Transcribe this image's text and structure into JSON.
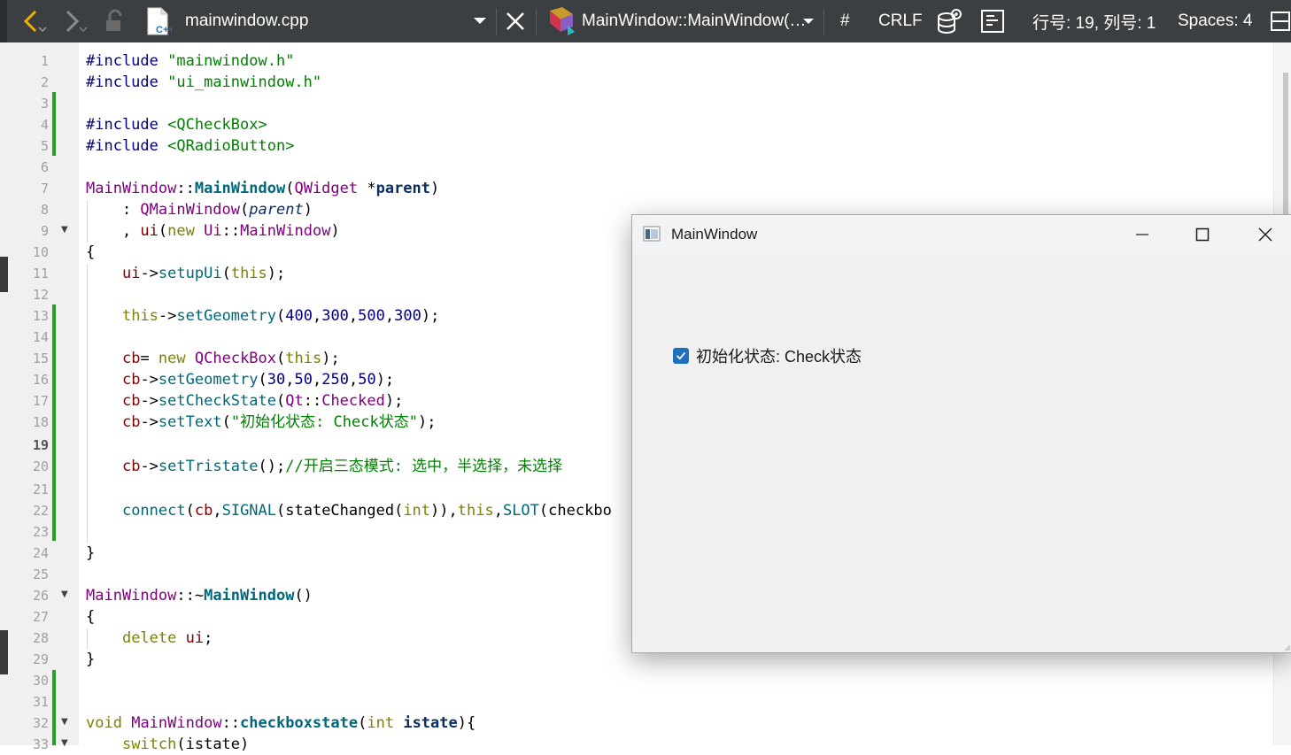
{
  "toolbar": {
    "file_name": "mainwindow.cpp",
    "symbol": "MainWindow::MainWindow(…",
    "hash": "#",
    "line_ending": "CRLF",
    "position": "行号: 19, 列号: 1",
    "indent": "Spaces: 4"
  },
  "editor": {
    "current_line": 19,
    "line_numbers": [
      "1",
      "2",
      "3",
      "4",
      "5",
      "6",
      "7",
      "8",
      "9",
      "10",
      "11",
      "12",
      "13",
      "14",
      "15",
      "16",
      "17",
      "18",
      "19",
      "20",
      "21",
      "22",
      "23",
      "24",
      "25",
      "26",
      "27",
      "28",
      "29",
      "30",
      "31",
      "32",
      "33"
    ],
    "lines": {
      "l1": "\"mainwindow.h\"",
      "l2": "\"ui_mainwindow.h\"",
      "l4": "<QCheckBox>",
      "l5": "<QRadioButton>",
      "l18_text": "\"初始化状态: Check状态\"",
      "l20_comment": "//开启三态模式: 选中，半选择，未选择",
      "l22_tail": "checkbo"
    }
  },
  "window": {
    "title": "MainWindow",
    "checkbox_label": "初始化状态: Check状态",
    "checkbox_checked": true,
    "accent": "#1f6fbf"
  },
  "colors": {
    "toolbar_bg": "#3c3f41",
    "change_bar": "#28a028"
  }
}
